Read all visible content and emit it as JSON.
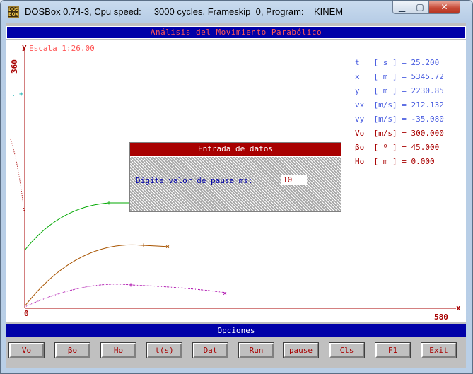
{
  "window": {
    "title": "DOSBox 0.74-3, Cpu speed:     3000 cycles, Frameskip  0, Program:    KINEM",
    "icon_text": "DOS BOX"
  },
  "app": {
    "header": "Análisis del Movimiento Parabólico",
    "scale_label": "Escala 1:26.00",
    "y_axis_label": "y",
    "y_max_label": "360",
    "x_axis_label": "x",
    "x_max_label": "580",
    "origin_label": "0",
    "readouts": [
      {
        "name": "t",
        "text": "t   [ s ] = 25.200",
        "color": "blue"
      },
      {
        "name": "x",
        "text": "x   [ m ] = 5345.72",
        "color": "blue"
      },
      {
        "name": "y",
        "text": "y   [ m ] = 2230.85",
        "color": "blue"
      },
      {
        "name": "vx",
        "text": "vx  [m/s] = 212.132",
        "color": "blue"
      },
      {
        "name": "vy",
        "text": "vy  [m/s] = -35.080",
        "color": "blue"
      },
      {
        "name": "vo",
        "text": "Vo  [m/s] = 300.000",
        "color": "red"
      },
      {
        "name": "beta",
        "text": "βo  [ º ] = 45.000",
        "color": "red"
      },
      {
        "name": "ho",
        "text": "Ho  [ m ] = 0.000",
        "color": "red"
      }
    ],
    "dialog": {
      "title": "Entrada de datos",
      "prompt": "Digite valor de pausa ms:",
      "value": "10"
    },
    "options_label": "Opciones",
    "buttons": [
      "Vo",
      "βo",
      "Ho",
      "t(s)",
      "Dat",
      "Run",
      "pause",
      "Cls",
      "F1",
      "Exit"
    ]
  },
  "colors": {
    "dos_blue": "#0000a8",
    "dos_red": "#a80000",
    "trajectory_green": "#00a800",
    "trajectory_brown": "#a85400",
    "trajectory_magenta": "#a800a8"
  }
}
